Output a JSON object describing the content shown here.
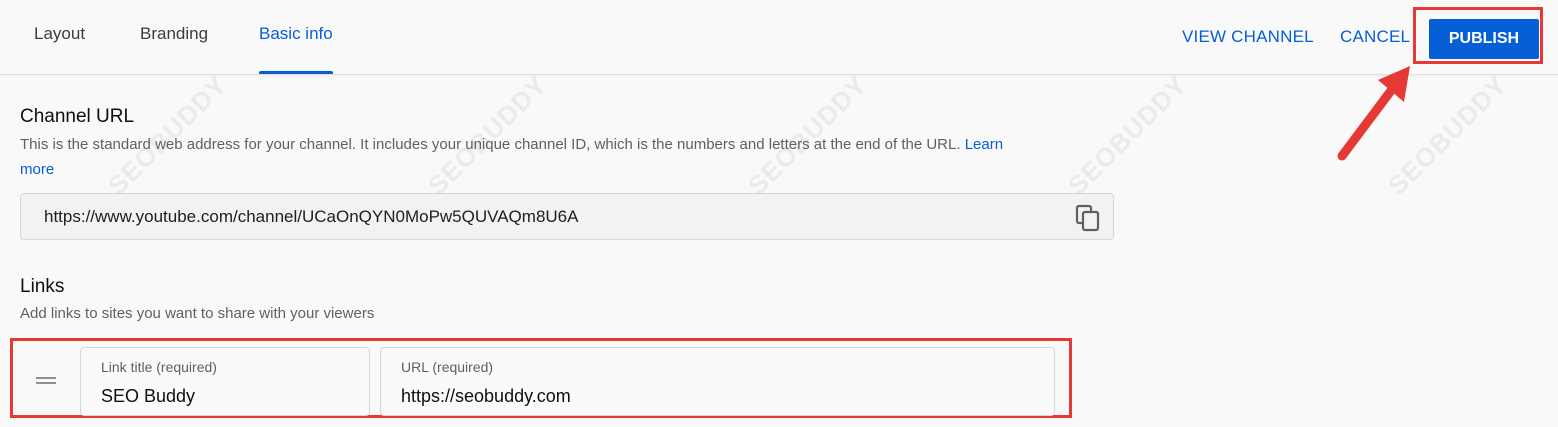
{
  "tabs": [
    {
      "label": "Layout"
    },
    {
      "label": "Branding"
    },
    {
      "label": "Basic info"
    }
  ],
  "actions": {
    "view_channel": "VIEW CHANNEL",
    "cancel": "CANCEL",
    "publish": "PUBLISH"
  },
  "channel_url": {
    "title": "Channel URL",
    "description": "This is the standard web address for your channel. It includes your unique channel ID, which is the numbers and letters at the end of the URL.",
    "learn_more": "Learn more",
    "learn_more_line1": "Learn",
    "learn_more_line2": "more",
    "value": "https://www.youtube.com/channel/UCaOnQYN0MoPw5QUVAQm8U6A",
    "copy_icon": "copy-icon"
  },
  "links": {
    "title": "Links",
    "description": "Add links to sites you want to share with your viewers",
    "items": [
      {
        "title_label": "Link title (required)",
        "title_value": "SEO Buddy",
        "url_label": "URL (required)",
        "url_value": "https://seobuddy.com"
      }
    ]
  },
  "watermark": "SEOBUDDY",
  "colors": {
    "accent": "#065fd4",
    "highlight": "#e53935"
  }
}
